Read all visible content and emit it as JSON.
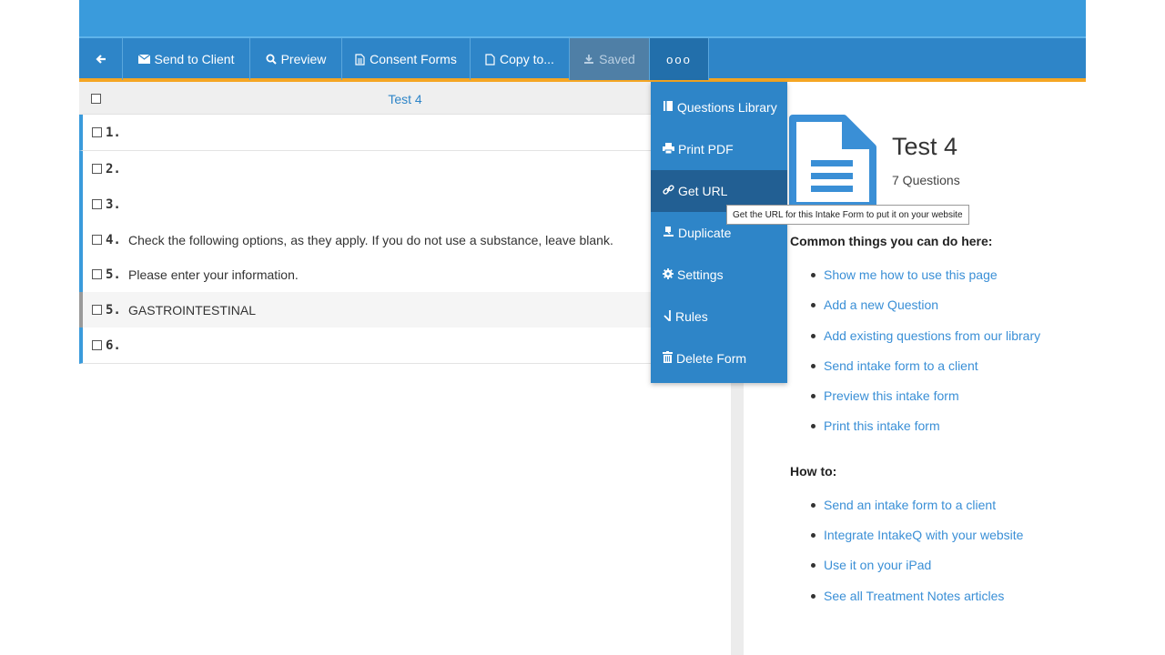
{
  "toolbar": {
    "back_icon": "arrow-left-icon",
    "send_to_client": "Send to Client",
    "preview": "Preview",
    "consent_forms": "Consent Forms",
    "copy_to": "Copy to...",
    "saved": "Saved",
    "more": "ooo"
  },
  "list": {
    "title": "Test 4",
    "rows": [
      {
        "num": "1.",
        "text": ""
      },
      {
        "num": "2.",
        "text": ""
      },
      {
        "num": "3.",
        "text": ""
      },
      {
        "num": "4.",
        "text": "Check the following options, as they apply. If you do not use a substance, leave blank."
      },
      {
        "num": "5.",
        "text": "Please enter your information."
      },
      {
        "num": "5.",
        "text": "GASTROINTESTINAL"
      },
      {
        "num": "6.",
        "text": ""
      }
    ]
  },
  "menu": {
    "items": [
      {
        "label": "Questions Library",
        "icon": "book-icon"
      },
      {
        "label": "Print PDF",
        "icon": "printer-icon"
      },
      {
        "label": "Get URL",
        "icon": "link-icon"
      },
      {
        "label": "Duplicate",
        "icon": "duplicate-icon"
      },
      {
        "label": "Settings",
        "icon": "gear-icon"
      },
      {
        "label": "Rules",
        "icon": "rules-icon"
      },
      {
        "label": "Delete Form",
        "icon": "trash-icon"
      }
    ],
    "tooltip": "Get the URL for this Intake Form to put it on your website"
  },
  "info": {
    "form_title": "Test 4",
    "question_count": "7 Questions",
    "common_title": "Common things you can do here:",
    "common_links": [
      "Show me how to use this page",
      "Add a new Question",
      "Add existing questions from our library",
      "Send intake form to a client",
      "Preview this intake form",
      "Print this intake form"
    ],
    "howto_title": "How to:",
    "howto_links": [
      "Send an intake form to a client",
      "Integrate IntakeQ with your website",
      "Use it on your iPad",
      "See all Treatment Notes articles"
    ]
  },
  "colors": {
    "primary": "#2e85c8",
    "topbar": "#3a9bdc",
    "accent_orange": "#f5a623",
    "link": "#3a8fd6"
  }
}
